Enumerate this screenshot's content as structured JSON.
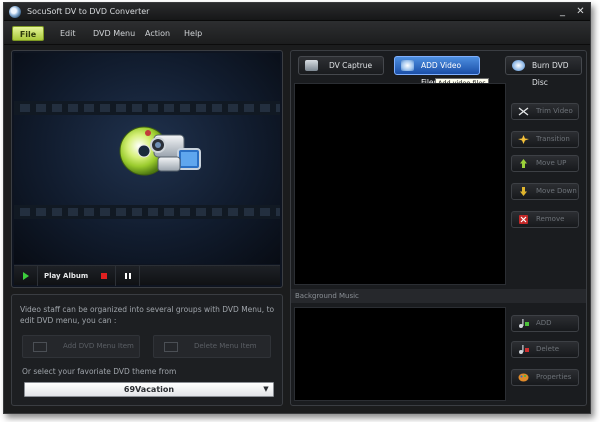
{
  "window": {
    "title": "SocuSoft DV to DVD Converter",
    "minimize": "_",
    "close": "✕"
  },
  "menu": [
    "File",
    "Edit",
    "DVD Menu",
    "Action",
    "Help"
  ],
  "player": {
    "play_album": "Play  Album"
  },
  "organize": {
    "description": "Video staff can be organized into several groups with DVD Menu, to edit DVD menu, you can :",
    "add_item": "Add DVD Menu Item",
    "delete_item": "Delete Menu Item",
    "theme_prompt": "Or  select  your  favoriate  DVD  theme from",
    "theme_value": "69Vacation"
  },
  "toolbar": {
    "dv_capture": "DV Captrue",
    "add_video": "ADD Video Files",
    "burn": "Burn DVD Disc",
    "tooltip": "Add video files"
  },
  "video_actions": [
    "Trim Video",
    "Transition",
    "Move  UP",
    "Move Down",
    "Remove"
  ],
  "music": {
    "label": "Background Music",
    "actions": [
      "ADD",
      "Delete",
      "Properties"
    ]
  },
  "colors": {
    "accent_green": "#a9c83a",
    "accent_blue": "#1b4fa8",
    "background": "#1b1c1d"
  }
}
